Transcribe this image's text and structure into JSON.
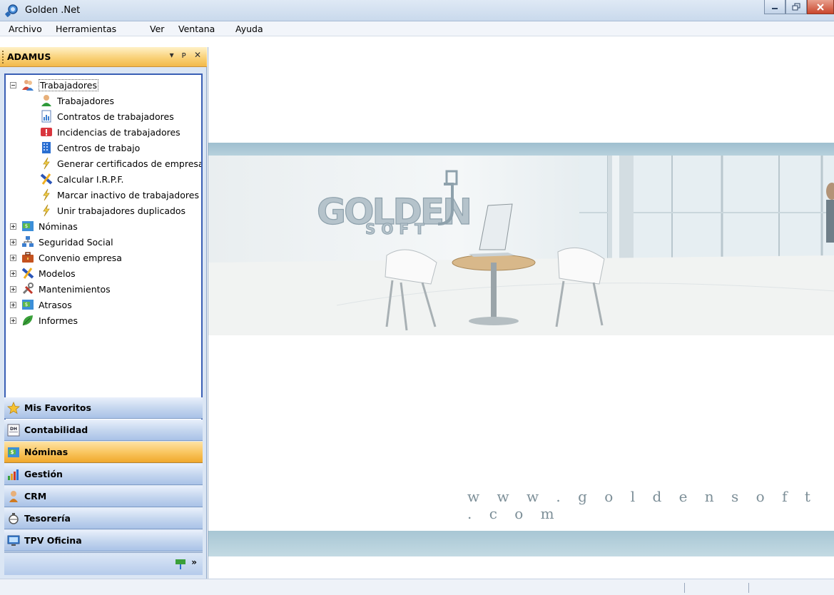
{
  "window": {
    "title": "Golden .Net"
  },
  "menu": [
    "Archivo",
    "Herramientas",
    "Ver",
    "Ventana",
    "Ayuda"
  ],
  "panel": {
    "title": "ADAMUS",
    "tree": {
      "root": {
        "label": "Trabajadores",
        "expanded": true
      },
      "children": [
        {
          "label": "Trabajadores",
          "icon": "person-icon"
        },
        {
          "label": "Contratos de trabajadores",
          "icon": "document-chart-icon"
        },
        {
          "label": "Incidencias de trabajadores",
          "icon": "incident-icon"
        },
        {
          "label": "Centros de trabajo",
          "icon": "building-icon"
        },
        {
          "label": "Generar certificados de empresa",
          "icon": "lightning-icon"
        },
        {
          "label": "Calcular I.R.P.F.",
          "icon": "calculator-icon"
        },
        {
          "label": "Marcar inactivo de trabajadores",
          "icon": "lightning-icon"
        },
        {
          "label": "Unir trabajadores duplicados",
          "icon": "lightning-icon"
        }
      ],
      "groups": [
        {
          "label": "Nóminas",
          "icon": "money-icon"
        },
        {
          "label": "Seguridad Social",
          "icon": "network-icon"
        },
        {
          "label": "Convenio empresa",
          "icon": "briefcase-icon"
        },
        {
          "label": "Modelos",
          "icon": "calculator-icon"
        },
        {
          "label": "Mantenimientos",
          "icon": "tools-icon"
        },
        {
          "label": "Atrasos",
          "icon": "money-icon"
        },
        {
          "label": "Informes",
          "icon": "leaf-icon"
        }
      ]
    },
    "nav_buttons": [
      {
        "label": "Mis Favoritos",
        "icon": "star-icon",
        "active": false
      },
      {
        "label": "Contabilidad",
        "icon": "ledger-icon",
        "active": false
      },
      {
        "label": "Nóminas",
        "icon": "money-icon",
        "active": true
      },
      {
        "label": "Gestión",
        "icon": "bar-chart-icon",
        "active": false
      },
      {
        "label": "CRM",
        "icon": "person-icon",
        "active": false
      },
      {
        "label": "Tesorería",
        "icon": "treasury-icon",
        "active": false
      },
      {
        "label": "TPV Oficina",
        "icon": "monitor-icon",
        "active": false
      }
    ]
  },
  "banner": {
    "logo_text": "GOLDEN SOFT",
    "website": "w w w . g o l d e n s o f t . c o m"
  },
  "colors": {
    "active_nav": "#f9c45d",
    "tree_border": "#3a5fb5",
    "banner_strip": "#a8c6d4"
  }
}
